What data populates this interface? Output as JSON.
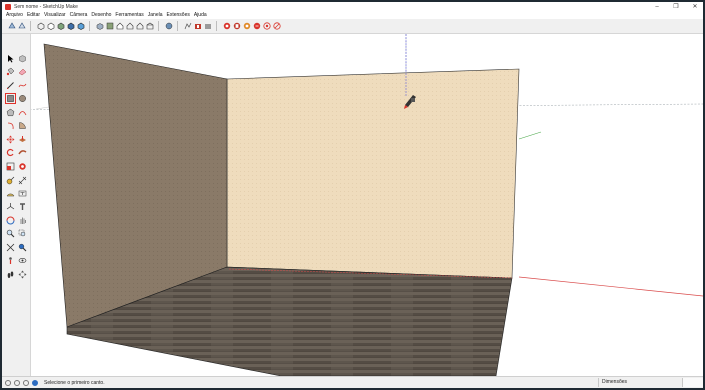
{
  "window": {
    "title": "Sem nome - SketchUp Make",
    "minimize": "–",
    "maximize": "❐",
    "close": "✕"
  },
  "menu": [
    "Arquivo",
    "Editar",
    "Visualizar",
    "Câmera",
    "Desenho",
    "Ferramentas",
    "Janela",
    "Extensões",
    "Ajuda"
  ],
  "status": {
    "message": "Selecione o primeiro canto.",
    "measurements_label": "Dimensões",
    "measurements_value": ""
  },
  "colors": {
    "accent": "#e0322b",
    "wall_back": "#efdcbd",
    "wall_left": "#8a7a68",
    "floor": "#5e564d",
    "axis_red": "#d94a4a",
    "axis_green": "#4aa84a",
    "axis_blue": "#4a4ad9"
  },
  "active_tool": "rectangle-tool"
}
